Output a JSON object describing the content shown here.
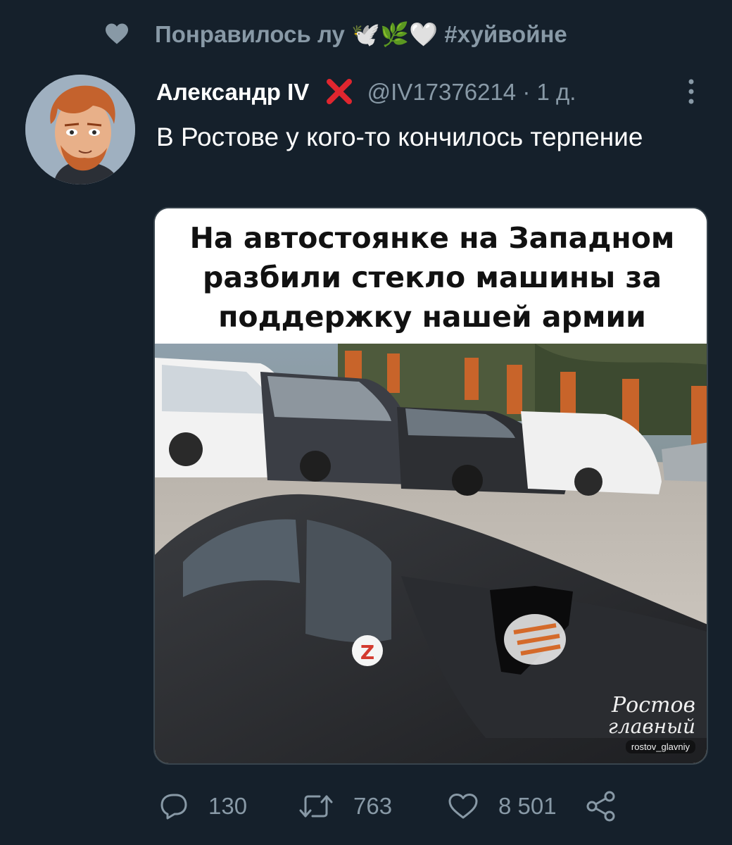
{
  "social_context": {
    "icon": "heart-icon",
    "text": "Понравилось лу 🕊️🌿🤍 #хуйвойне"
  },
  "tweet": {
    "author_name": "Александр IV",
    "author_badge": "❌",
    "handle": "@IV17376214",
    "separator": "·",
    "time": "1 д.",
    "text": "В Ростове у кого-то кончилось терпение",
    "media": {
      "caption_lines": [
        "На автостоянке на Западном",
        "разбили стекло машины за",
        "поддержку нашей армии"
      ],
      "watermark_line1": "Ростов",
      "watermark_line2": "главный",
      "watermark_handle": "rostov_glavniy"
    }
  },
  "actions": {
    "reply": {
      "icon": "reply-icon",
      "count": "130"
    },
    "retweet": {
      "icon": "retweet-icon",
      "count": "763"
    },
    "like": {
      "icon": "heart-icon",
      "count": "8 501"
    },
    "share": {
      "icon": "share-icon"
    }
  },
  "colors": {
    "background": "#15202b",
    "muted": "#8899a6",
    "text": "#ffffff"
  }
}
